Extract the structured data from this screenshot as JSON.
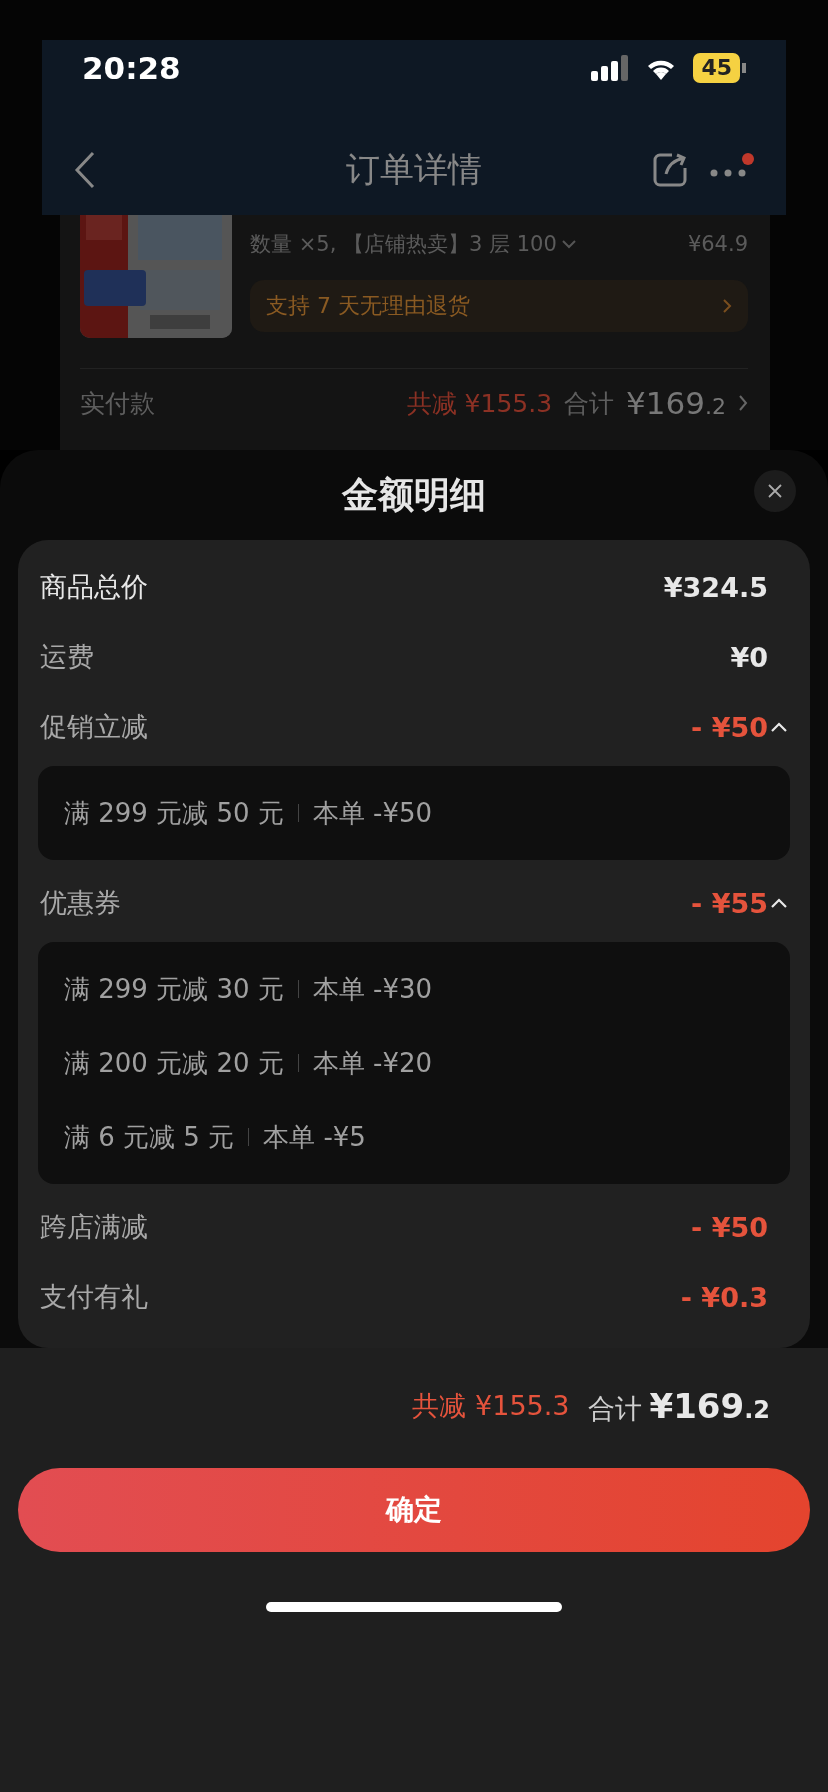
{
  "status_bar": {
    "time": "20:28",
    "battery": "45"
  },
  "background_page": {
    "title": "订单详情",
    "product": {
      "spec": "数量 ×5, 【店铺热卖】3 层 100",
      "price": "¥64.9",
      "return_policy": "支持 7 天无理由退货"
    },
    "payment": {
      "label": "实付款",
      "discount": "共减 ¥155.3",
      "total_label": "合计",
      "total": "¥169.2"
    }
  },
  "sheet": {
    "title": "金额明细",
    "rows": [
      {
        "kind": "total",
        "label": "商品总价",
        "value": "¥324.5"
      },
      {
        "kind": "plain",
        "label": "运费",
        "value": "¥0"
      },
      {
        "kind": "discount",
        "label": "促销立减",
        "value": "- ¥50",
        "expanded": true,
        "details": [
          {
            "rule": "满 299 元减 50 元",
            "amount": "本单 -¥50"
          }
        ]
      },
      {
        "kind": "discount",
        "label": "优惠券",
        "value": "- ¥55",
        "expanded": true,
        "details": [
          {
            "rule": "满 299 元减 30 元",
            "amount": "本单 -¥30"
          },
          {
            "rule": "满 200 元减 20 元",
            "amount": "本单 -¥20"
          },
          {
            "rule": "满 6 元减 5 元",
            "amount": "本单 -¥5"
          }
        ]
      },
      {
        "kind": "discount",
        "label": "跨店满减",
        "value": "- ¥50"
      },
      {
        "kind": "discount",
        "label": "支付有礼",
        "value": "- ¥0.3"
      }
    ],
    "footer": {
      "discount": "共减 ¥155.3",
      "total_label": "合计",
      "total": "¥169.2"
    },
    "confirm_button": "确定"
  }
}
